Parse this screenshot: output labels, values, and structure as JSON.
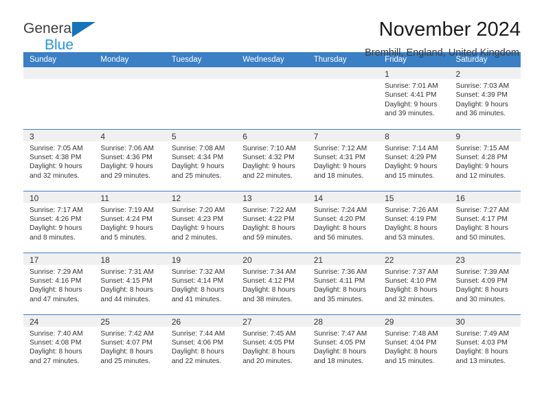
{
  "brand": {
    "name_top": "General",
    "name_bottom": "Blue",
    "accent_color": "#2196e3",
    "triangle_color": "#1574bb"
  },
  "header": {
    "title": "November 2024",
    "subtitle": "Bremhill, England, United Kingdom"
  },
  "theme": {
    "header_blue": "#3b7fc4",
    "day_band_gray": "#f0f0f0",
    "text": "#333333"
  },
  "weekday_headers": [
    "Sunday",
    "Monday",
    "Tuesday",
    "Wednesday",
    "Thursday",
    "Friday",
    "Saturday"
  ],
  "labels": {
    "sunrise_prefix": "Sunrise:",
    "sunset_prefix": "Sunset:",
    "daylight_prefix": "Daylight:"
  },
  "weeks": [
    [
      {
        "empty": true
      },
      {
        "empty": true
      },
      {
        "empty": true
      },
      {
        "empty": true
      },
      {
        "empty": true
      },
      {
        "day": "1",
        "sunrise": "Sunrise: 7:01 AM",
        "sunset": "Sunset: 4:41 PM",
        "daylight1": "Daylight: 9 hours",
        "daylight2": "and 39 minutes."
      },
      {
        "day": "2",
        "sunrise": "Sunrise: 7:03 AM",
        "sunset": "Sunset: 4:39 PM",
        "daylight1": "Daylight: 9 hours",
        "daylight2": "and 36 minutes."
      }
    ],
    [
      {
        "day": "3",
        "sunrise": "Sunrise: 7:05 AM",
        "sunset": "Sunset: 4:38 PM",
        "daylight1": "Daylight: 9 hours",
        "daylight2": "and 32 minutes."
      },
      {
        "day": "4",
        "sunrise": "Sunrise: 7:06 AM",
        "sunset": "Sunset: 4:36 PM",
        "daylight1": "Daylight: 9 hours",
        "daylight2": "and 29 minutes."
      },
      {
        "day": "5",
        "sunrise": "Sunrise: 7:08 AM",
        "sunset": "Sunset: 4:34 PM",
        "daylight1": "Daylight: 9 hours",
        "daylight2": "and 25 minutes."
      },
      {
        "day": "6",
        "sunrise": "Sunrise: 7:10 AM",
        "sunset": "Sunset: 4:32 PM",
        "daylight1": "Daylight: 9 hours",
        "daylight2": "and 22 minutes."
      },
      {
        "day": "7",
        "sunrise": "Sunrise: 7:12 AM",
        "sunset": "Sunset: 4:31 PM",
        "daylight1": "Daylight: 9 hours",
        "daylight2": "and 18 minutes."
      },
      {
        "day": "8",
        "sunrise": "Sunrise: 7:14 AM",
        "sunset": "Sunset: 4:29 PM",
        "daylight1": "Daylight: 9 hours",
        "daylight2": "and 15 minutes."
      },
      {
        "day": "9",
        "sunrise": "Sunrise: 7:15 AM",
        "sunset": "Sunset: 4:28 PM",
        "daylight1": "Daylight: 9 hours",
        "daylight2": "and 12 minutes."
      }
    ],
    [
      {
        "day": "10",
        "sunrise": "Sunrise: 7:17 AM",
        "sunset": "Sunset: 4:26 PM",
        "daylight1": "Daylight: 9 hours",
        "daylight2": "and 8 minutes."
      },
      {
        "day": "11",
        "sunrise": "Sunrise: 7:19 AM",
        "sunset": "Sunset: 4:24 PM",
        "daylight1": "Daylight: 9 hours",
        "daylight2": "and 5 minutes."
      },
      {
        "day": "12",
        "sunrise": "Sunrise: 7:20 AM",
        "sunset": "Sunset: 4:23 PM",
        "daylight1": "Daylight: 9 hours",
        "daylight2": "and 2 minutes."
      },
      {
        "day": "13",
        "sunrise": "Sunrise: 7:22 AM",
        "sunset": "Sunset: 4:22 PM",
        "daylight1": "Daylight: 8 hours",
        "daylight2": "and 59 minutes."
      },
      {
        "day": "14",
        "sunrise": "Sunrise: 7:24 AM",
        "sunset": "Sunset: 4:20 PM",
        "daylight1": "Daylight: 8 hours",
        "daylight2": "and 56 minutes."
      },
      {
        "day": "15",
        "sunrise": "Sunrise: 7:26 AM",
        "sunset": "Sunset: 4:19 PM",
        "daylight1": "Daylight: 8 hours",
        "daylight2": "and 53 minutes."
      },
      {
        "day": "16",
        "sunrise": "Sunrise: 7:27 AM",
        "sunset": "Sunset: 4:17 PM",
        "daylight1": "Daylight: 8 hours",
        "daylight2": "and 50 minutes."
      }
    ],
    [
      {
        "day": "17",
        "sunrise": "Sunrise: 7:29 AM",
        "sunset": "Sunset: 4:16 PM",
        "daylight1": "Daylight: 8 hours",
        "daylight2": "and 47 minutes."
      },
      {
        "day": "18",
        "sunrise": "Sunrise: 7:31 AM",
        "sunset": "Sunset: 4:15 PM",
        "daylight1": "Daylight: 8 hours",
        "daylight2": "and 44 minutes."
      },
      {
        "day": "19",
        "sunrise": "Sunrise: 7:32 AM",
        "sunset": "Sunset: 4:14 PM",
        "daylight1": "Daylight: 8 hours",
        "daylight2": "and 41 minutes."
      },
      {
        "day": "20",
        "sunrise": "Sunrise: 7:34 AM",
        "sunset": "Sunset: 4:12 PM",
        "daylight1": "Daylight: 8 hours",
        "daylight2": "and 38 minutes."
      },
      {
        "day": "21",
        "sunrise": "Sunrise: 7:36 AM",
        "sunset": "Sunset: 4:11 PM",
        "daylight1": "Daylight: 8 hours",
        "daylight2": "and 35 minutes."
      },
      {
        "day": "22",
        "sunrise": "Sunrise: 7:37 AM",
        "sunset": "Sunset: 4:10 PM",
        "daylight1": "Daylight: 8 hours",
        "daylight2": "and 32 minutes."
      },
      {
        "day": "23",
        "sunrise": "Sunrise: 7:39 AM",
        "sunset": "Sunset: 4:09 PM",
        "daylight1": "Daylight: 8 hours",
        "daylight2": "and 30 minutes."
      }
    ],
    [
      {
        "day": "24",
        "sunrise": "Sunrise: 7:40 AM",
        "sunset": "Sunset: 4:08 PM",
        "daylight1": "Daylight: 8 hours",
        "daylight2": "and 27 minutes."
      },
      {
        "day": "25",
        "sunrise": "Sunrise: 7:42 AM",
        "sunset": "Sunset: 4:07 PM",
        "daylight1": "Daylight: 8 hours",
        "daylight2": "and 25 minutes."
      },
      {
        "day": "26",
        "sunrise": "Sunrise: 7:44 AM",
        "sunset": "Sunset: 4:06 PM",
        "daylight1": "Daylight: 8 hours",
        "daylight2": "and 22 minutes."
      },
      {
        "day": "27",
        "sunrise": "Sunrise: 7:45 AM",
        "sunset": "Sunset: 4:05 PM",
        "daylight1": "Daylight: 8 hours",
        "daylight2": "and 20 minutes."
      },
      {
        "day": "28",
        "sunrise": "Sunrise: 7:47 AM",
        "sunset": "Sunset: 4:05 PM",
        "daylight1": "Daylight: 8 hours",
        "daylight2": "and 18 minutes."
      },
      {
        "day": "29",
        "sunrise": "Sunrise: 7:48 AM",
        "sunset": "Sunset: 4:04 PM",
        "daylight1": "Daylight: 8 hours",
        "daylight2": "and 15 minutes."
      },
      {
        "day": "30",
        "sunrise": "Sunrise: 7:49 AM",
        "sunset": "Sunset: 4:03 PM",
        "daylight1": "Daylight: 8 hours",
        "daylight2": "and 13 minutes."
      }
    ]
  ]
}
